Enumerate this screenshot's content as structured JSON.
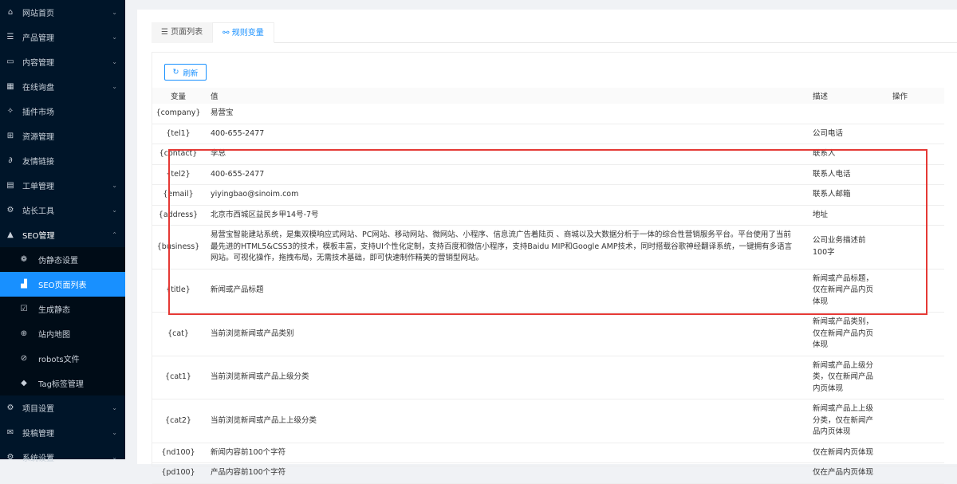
{
  "sidebar": {
    "items": [
      {
        "label": "网站首页",
        "icon": "home-icon",
        "glyph": "⌂",
        "chev": "⌄"
      },
      {
        "label": "产品管理",
        "icon": "list-icon",
        "glyph": "☰",
        "chev": "⌄"
      },
      {
        "label": "内容管理",
        "icon": "content-icon",
        "glyph": "▭",
        "chev": "⌄"
      },
      {
        "label": "在线询盘",
        "icon": "table-icon",
        "glyph": "▦",
        "chev": "⌄"
      },
      {
        "label": "插件市场",
        "icon": "pin-icon",
        "glyph": "✧",
        "chev": ""
      },
      {
        "label": "资源管理",
        "icon": "grid-icon",
        "glyph": "⊞",
        "chev": ""
      },
      {
        "label": "友情链接",
        "icon": "link-icon",
        "glyph": "∂",
        "chev": ""
      },
      {
        "label": "工单管理",
        "icon": "document-icon",
        "glyph": "▤",
        "chev": "⌄"
      },
      {
        "label": "站长工具",
        "icon": "tools-icon",
        "glyph": "⚙",
        "chev": "⌄"
      },
      {
        "label": "SEO管理",
        "icon": "warning-icon",
        "glyph": "▲",
        "chev": "⌃"
      }
    ],
    "sub_items": [
      {
        "label": "伪静态设置",
        "icon": "settings-icon",
        "glyph": "❁"
      },
      {
        "label": "SEO页面列表",
        "icon": "area-chart-icon",
        "glyph": "▟"
      },
      {
        "label": "生成静态",
        "icon": "checkbox-icon",
        "glyph": "☑"
      },
      {
        "label": "站内地图",
        "icon": "sitemap-icon",
        "glyph": "⊕"
      },
      {
        "label": "robots文件",
        "icon": "compass-icon",
        "glyph": "⊘"
      },
      {
        "label": "Tag标签管理",
        "icon": "tag-icon",
        "glyph": "◆"
      }
    ],
    "bottom_items": [
      {
        "label": "项目设置",
        "icon": "gear-icon",
        "glyph": "⚙",
        "chev": "⌄"
      },
      {
        "label": "投稿管理",
        "icon": "mail-icon",
        "glyph": "✉",
        "chev": "⌄"
      },
      {
        "label": "系统设置",
        "icon": "gear-icon",
        "glyph": "⚙",
        "chev": "⌄"
      }
    ]
  },
  "tabs": [
    {
      "label": "页面列表",
      "glyph": "☰"
    },
    {
      "label": "规则变量",
      "glyph": "⚯"
    }
  ],
  "refresh_label": "刷新",
  "table": {
    "headers": [
      "变量",
      "值",
      "描述",
      "操作"
    ],
    "rows": [
      {
        "var": "{company}",
        "val": "易营宝",
        "desc": ""
      },
      {
        "var": "{tel1}",
        "val": "400-655-2477",
        "desc": "公司电话"
      },
      {
        "var": "{contact}",
        "val": "李总",
        "desc": "联系人"
      },
      {
        "var": "{tel2}",
        "val": "400-655-2477",
        "desc": "联系人电话"
      },
      {
        "var": "{email}",
        "val": "yiyingbao@sinoim.com",
        "desc": "联系人邮箱"
      },
      {
        "var": "{address}",
        "val": "北京市西城区益民乡甲14号-7号",
        "desc": "地址"
      },
      {
        "var": "{business}",
        "val": "易营宝智能建站系统，是集双模响应式网站、PC网站、移动网站、微网站、小程序、信息流广告着陆页 、商城以及大数据分析于一体的综合性营销服务平台。平台使用了当前最先进的HTML5&CSS3的技术，模板丰富，支持UI个性化定制，支持百度和微信小程序，支持Baidu MIP和Google AMP技术，同时搭载谷歌神经翻译系统，一键拥有多语言网站。可视化操作，拖拽布局，无需技术基础，即可快速制作精美的营销型网站。",
        "desc": "公司业务描述前100字"
      },
      {
        "var": "{title}",
        "val": "新闻或产品标题",
        "desc": "新闻或产品标题，仅在新闻产品内页体现"
      },
      {
        "var": "{cat}",
        "val": "当前浏览新闻或产品类别",
        "desc": "新闻或产品类别，仅在新闻产品内页体现"
      },
      {
        "var": "{cat1}",
        "val": "当前浏览新闻或产品上级分类",
        "desc": "新闻或产品上级分类，仅在新闻产品内页体现"
      },
      {
        "var": "{cat2}",
        "val": "当前浏览新闻或产品上上级分类",
        "desc": "新闻或产品上上级分类，仅在新闻产品内页体现"
      },
      {
        "var": "{nd100}",
        "val": "新闻内容前100个字符",
        "desc": "仅在新闻内页体现"
      },
      {
        "var": "{pd100}",
        "val": "产品内容前100个字符",
        "desc": "仅在产品内页体现"
      }
    ]
  }
}
